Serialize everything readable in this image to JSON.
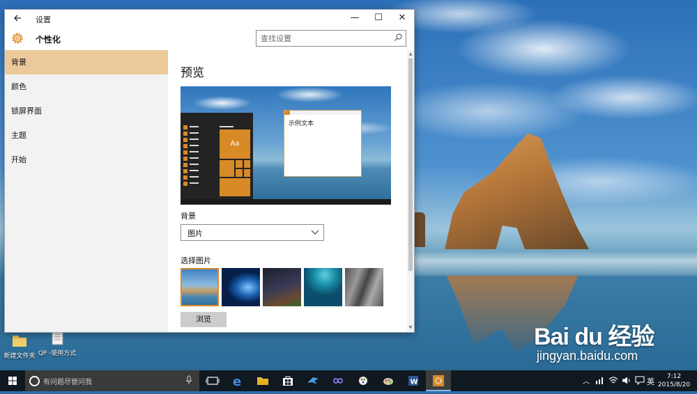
{
  "window": {
    "title": "设置",
    "app_title": "个性化",
    "back_icon": "back-arrow-icon",
    "minimize_label": "—",
    "maximize_label": "☐",
    "close_label": "✕"
  },
  "search": {
    "placeholder": "查找设置"
  },
  "sidebar": {
    "items": [
      {
        "label": "背景"
      },
      {
        "label": "颜色"
      },
      {
        "label": "锁屏界面"
      },
      {
        "label": "主题"
      },
      {
        "label": "开始"
      }
    ],
    "active_index": 0
  },
  "main": {
    "heading": "预览",
    "preview": {
      "sample_text": "示例文本",
      "tile_label": "Aa"
    },
    "background_label": "背景",
    "background_select": {
      "value": "图片"
    },
    "choose_picture_label": "选择图片",
    "browse_label": "浏览"
  },
  "desktop": {
    "icons": [
      {
        "label": "新建文件夹"
      },
      {
        "label": "QP -使用方式"
      }
    ],
    "watermark": {
      "logo": "Bai du 经验",
      "url": "jingyan.baidu.com"
    }
  },
  "taskbar": {
    "search_placeholder": "有问题尽管问我",
    "ime": "英",
    "time": "7:12",
    "date": "2015/8/20"
  },
  "colors": {
    "accent": "#d88a27",
    "active_nav": "#ecc99b",
    "taskbar": "#101820"
  }
}
